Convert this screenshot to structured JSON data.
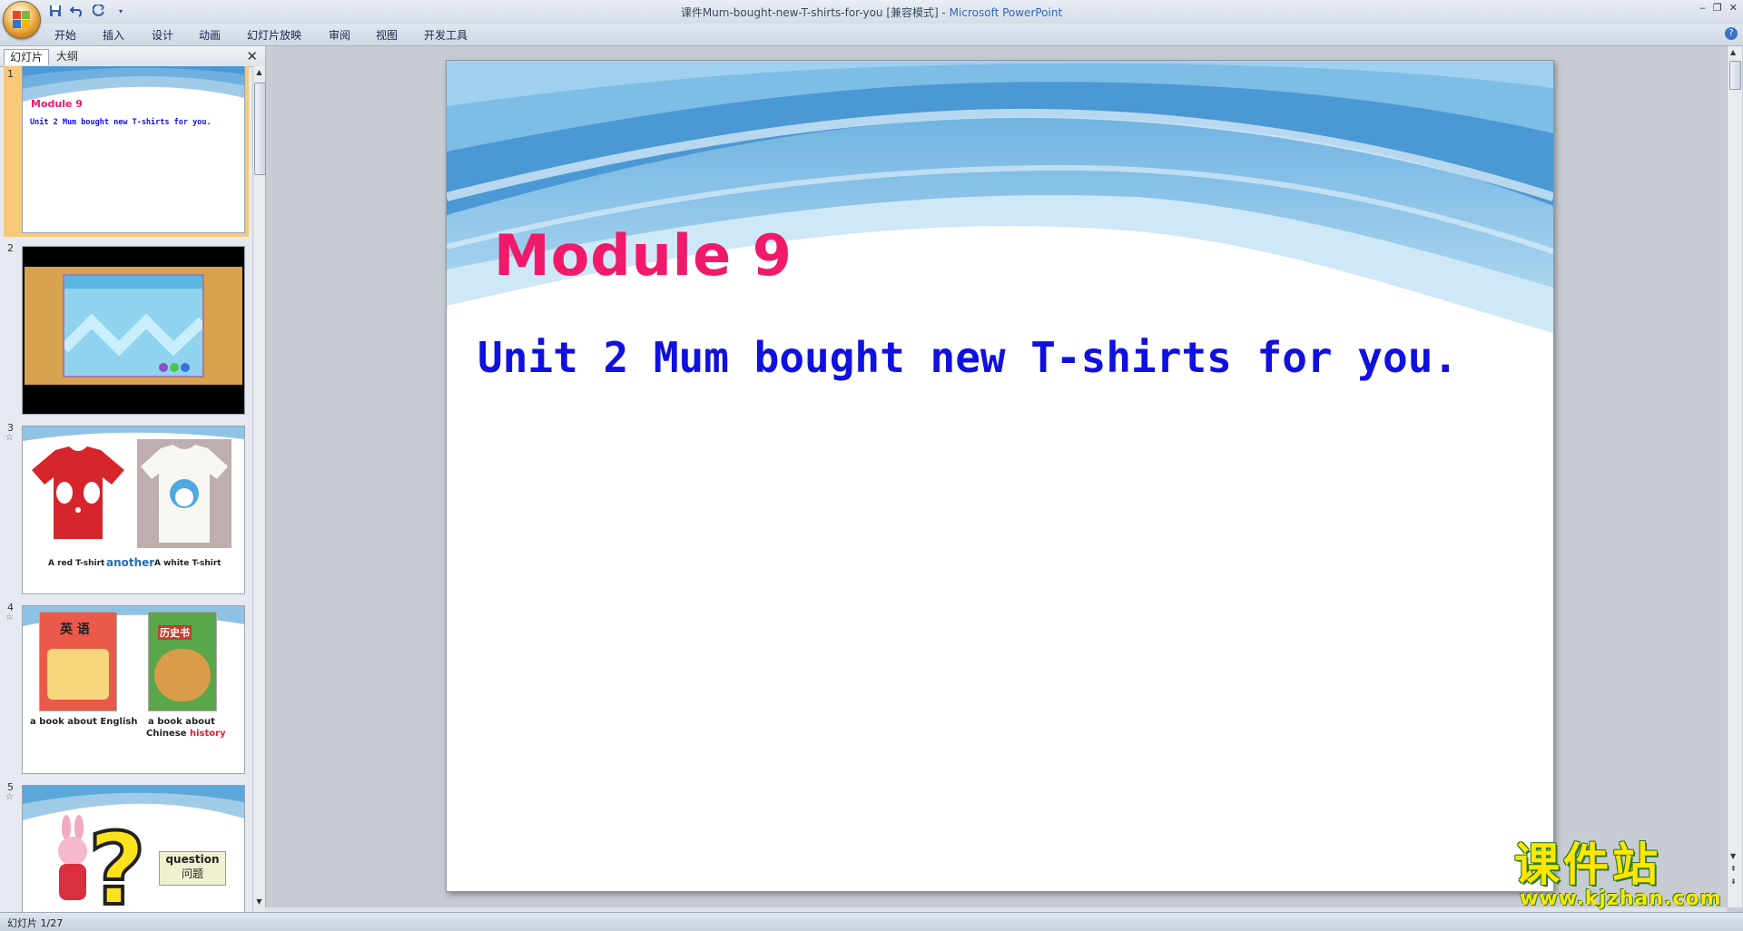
{
  "window": {
    "title": "课件Mum-bought-new-T-shirts-for-you [兼容模式]",
    "title_sep": " - ",
    "app_name": "Microsoft PowerPoint"
  },
  "quick_access": {
    "icons": [
      "save-icon",
      "undo-icon",
      "redo-icon",
      "customize-icon"
    ]
  },
  "ribbon": {
    "tabs": [
      "开始",
      "插入",
      "设计",
      "动画",
      "幻灯片放映",
      "审阅",
      "视图",
      "开发工具"
    ]
  },
  "left_panel": {
    "tab_slides": "幻灯片",
    "tab_outline": "大纲",
    "close": "✕"
  },
  "thumbnails": {
    "s1": {
      "num": "1",
      "title": "Module 9",
      "subtitle": "Unit 2 Mum bought new T-shirts for you."
    },
    "s2": {
      "num": "2"
    },
    "s3": {
      "num": "3",
      "left_label": "A red T-shirt",
      "mid_label": "another",
      "right_label": "A white T-shirt"
    },
    "s4": {
      "num": "4",
      "left_label": "a book about English",
      "right_label_1": "a book about",
      "right_label_2": "Chinese ",
      "right_label_hl": "history",
      "book1_title": "英 语",
      "book2_title": "历史书"
    },
    "s5": {
      "num": "5",
      "word": "question",
      "word_cn": "问题"
    }
  },
  "slide": {
    "title": "Module 9",
    "subtitle": "Unit 2 Mum bought new T-shirts for you."
  },
  "status_bar": {
    "slide_info": "幻灯片 1/27"
  },
  "watermark": {
    "cn": "课件站",
    "url": "www.kjzhan.com"
  },
  "colors": {
    "title_pink": "#f0196a",
    "subtitle_blue": "#1010e0",
    "accent_orange": "#f5b04e"
  }
}
